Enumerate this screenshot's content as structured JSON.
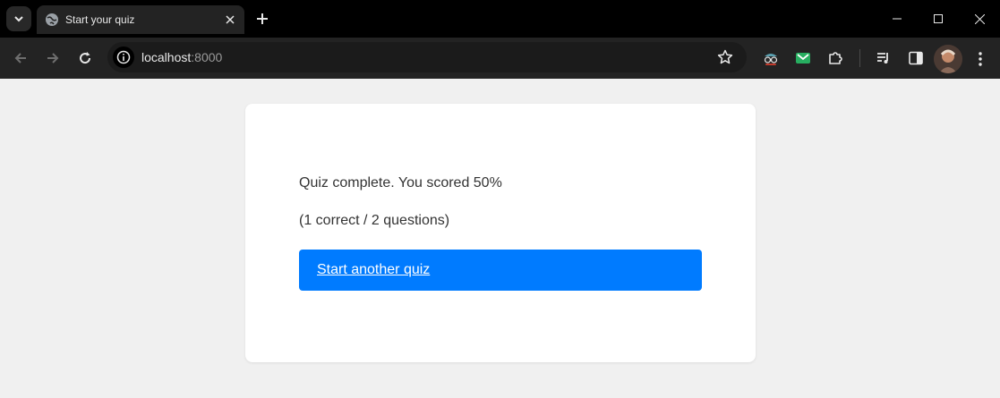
{
  "browser": {
    "tab": {
      "title": "Start your quiz"
    },
    "address": {
      "host": "localhost",
      "port": ":8000"
    }
  },
  "quiz": {
    "result_text": "Quiz complete. You scored 50%",
    "detail_text": "(1 correct / 2 questions)",
    "restart_label": "Start another quiz"
  },
  "colors": {
    "accent": "#007bff",
    "page_bg": "#f0f0f0",
    "card_bg": "#ffffff",
    "chrome_bg": "#232323",
    "titlebar_bg": "#000000"
  }
}
